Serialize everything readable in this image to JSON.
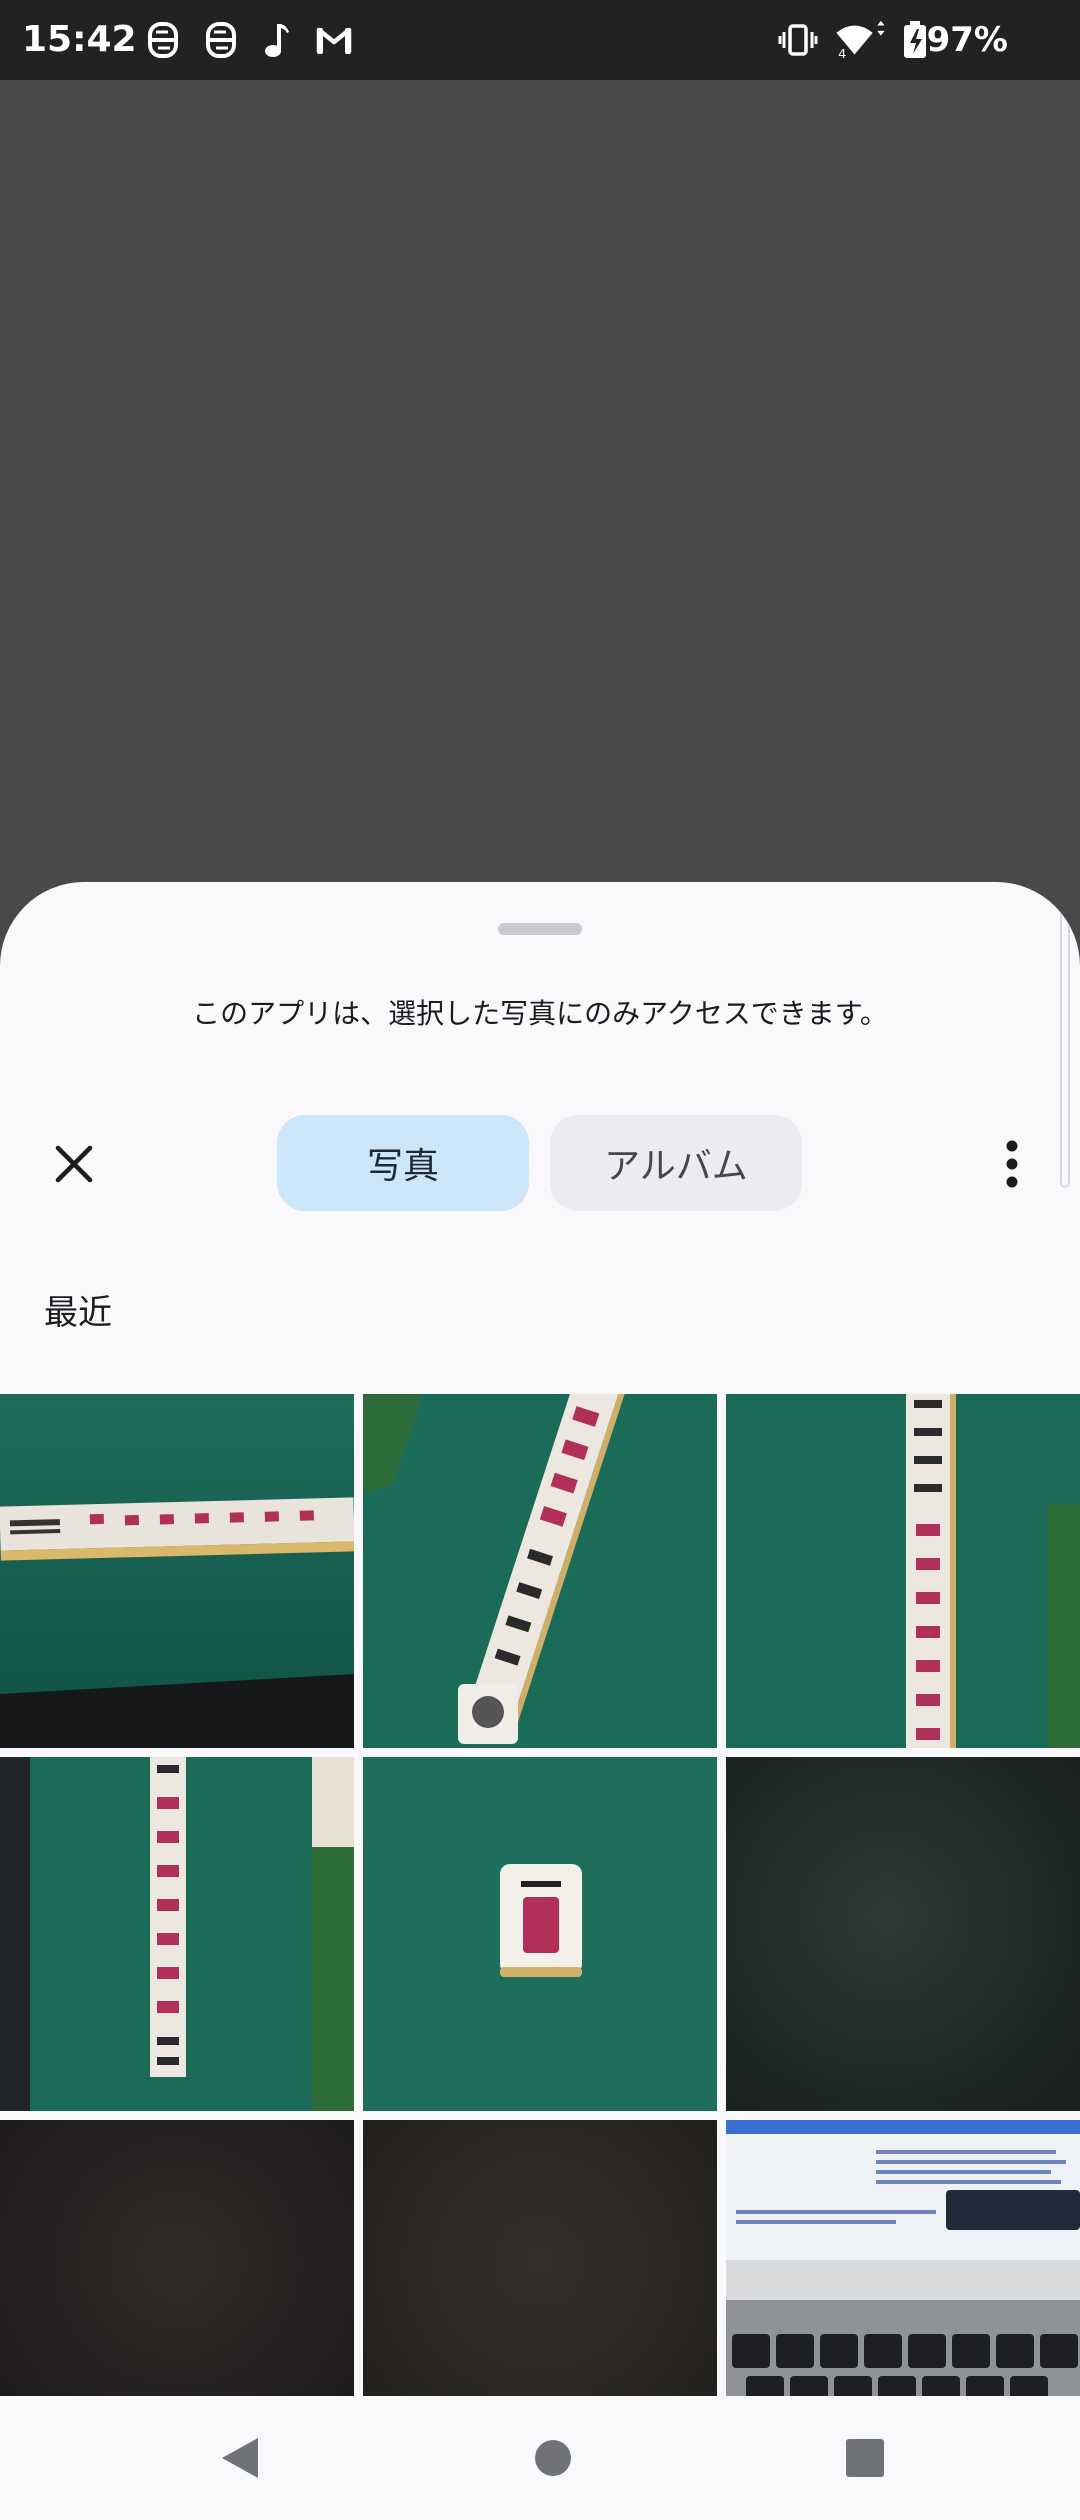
{
  "status_bar": {
    "time": "15:42",
    "battery": "97%",
    "notification_icons": [
      "s-app-icon",
      "s-app-icon",
      "music-note-icon",
      "gmail-icon"
    ],
    "system_icons": [
      "vibrate-icon",
      "wifi-icon",
      "battery-charging-icon"
    ],
    "wifi_badge": "4"
  },
  "sheet": {
    "notice": "このアプリは、選択した写真にのみアクセスできます。",
    "tabs": [
      {
        "label": "写真",
        "selected": true
      },
      {
        "label": "アルバム",
        "selected": false
      }
    ],
    "section_title": "最近"
  },
  "colors": {
    "sheet_bg": "#f9f9fc",
    "selected_tab": "#cde6f9",
    "unselected_tab": "#ececf0",
    "scrim": "#47494b"
  }
}
